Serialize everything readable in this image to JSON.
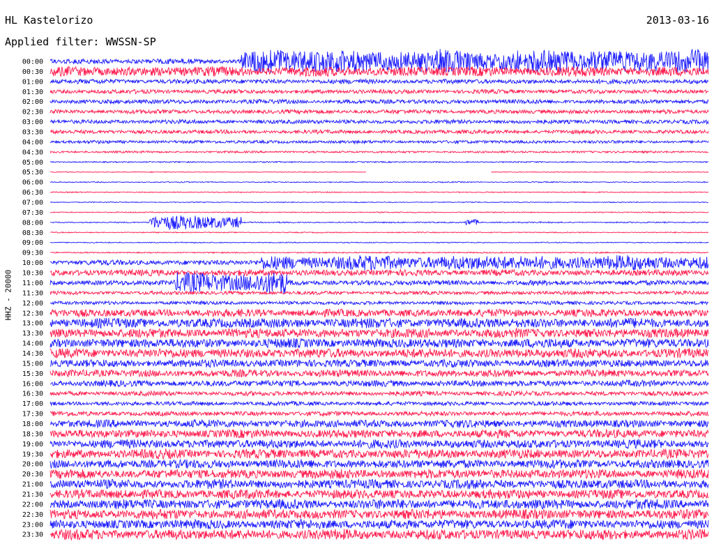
{
  "header": {
    "station": "HL Kastelorizo",
    "date": "2013-03-16",
    "filter": "Applied filter: WWSSN-SP",
    "channel": "HHZ - 20000"
  },
  "colors": {
    "even_row": "#1a1aff",
    "odd_row": "#ff1a4d",
    "text": "#000000",
    "background": "#ffffff"
  },
  "chart_data": {
    "type": "line",
    "title": "HL Kastelorizo",
    "date": "2013-03-16",
    "filter": "WWSSN-SP",
    "ylabel": "HHZ - 20000",
    "row_duration_minutes": 30,
    "row_colors_alternate": [
      "#1a1aff",
      "#ff1a4d"
    ],
    "row_labels": [
      "00:00",
      "00:30",
      "01:00",
      "01:30",
      "02:00",
      "02:30",
      "03:00",
      "03:30",
      "04:00",
      "04:30",
      "05:00",
      "05:30",
      "06:00",
      "06:30",
      "07:00",
      "07:30",
      "08:00",
      "08:30",
      "09:00",
      "09:30",
      "10:00",
      "10:30",
      "11:00",
      "11:30",
      "12:00",
      "12:30",
      "13:00",
      "13:30",
      "14:00",
      "14:30",
      "15:00",
      "15:30",
      "16:00",
      "16:30",
      "17:00",
      "17:30",
      "18:00",
      "18:30",
      "19:00",
      "19:30",
      "20:00",
      "20:30",
      "21:00",
      "21:30",
      "22:00",
      "22:30",
      "23:00",
      "23:30"
    ],
    "noise_level": [
      0.5,
      0.95,
      0.45,
      0.4,
      0.42,
      0.4,
      0.4,
      0.38,
      0.3,
      0.2,
      0.12,
      0.08,
      0.1,
      0.1,
      0.09,
      0.1,
      0.12,
      0.1,
      0.1,
      0.12,
      0.5,
      0.6,
      0.5,
      0.35,
      0.35,
      0.75,
      0.95,
      0.9,
      0.9,
      0.9,
      0.75,
      0.7,
      0.6,
      0.45,
      0.4,
      0.45,
      0.75,
      0.8,
      0.85,
      0.9,
      0.85,
      0.9,
      0.9,
      0.9,
      0.95,
      0.95,
      0.9,
      1.0
    ],
    "events": [
      {
        "row": "00:00",
        "start_fraction": 0.29,
        "end_fraction": 1.0,
        "amplitude": 1.8
      },
      {
        "row": "08:00",
        "start_fraction": 0.15,
        "end_fraction": 0.29,
        "amplitude": 1.3
      },
      {
        "row": "08:00",
        "start_fraction": 0.63,
        "end_fraction": 0.65,
        "amplitude": 0.6
      },
      {
        "row": "10:00",
        "start_fraction": 0.32,
        "end_fraction": 1.0,
        "amplitude": 0.9
      },
      {
        "row": "11:00",
        "start_fraction": 0.19,
        "end_fraction": 0.36,
        "amplitude": 1.6
      }
    ],
    "gaps": [
      {
        "row": "05:30",
        "start_fraction": 0.48,
        "end_fraction": 0.67
      }
    ]
  }
}
